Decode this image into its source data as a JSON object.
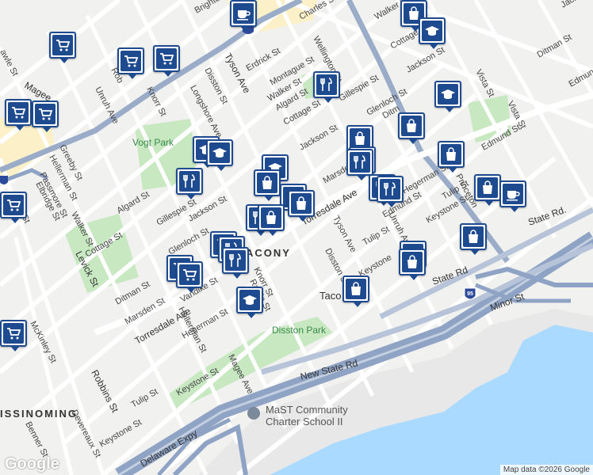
{
  "map": {
    "attribution": "Map data ©2026 Google",
    "logo": "Google",
    "area_labels": [
      "TACONY",
      "ISSINOMING"
    ],
    "parks": [
      "Vogt Park",
      "Disston Park"
    ],
    "school": "MaST Community Charter School II",
    "highways": [
      "New State Rd",
      "Delaware Expy",
      "State Rd.",
      "I-95"
    ],
    "streets": [
      "Brighton St",
      "Charles St",
      "Tyson Ave",
      "Erdrick St",
      "Wellington St",
      "Walker St",
      "Cottage St",
      "Jackson St",
      "Ditman St",
      "Vista St",
      "Edmund St",
      "Montague St",
      "Disston St",
      "Longshore Ave",
      "Unruh Ave",
      "Knorr St",
      "Magee Ave",
      "Greeby St",
      "Hellerman St",
      "Passmore St",
      "Elbridge St",
      "Algard St",
      "Gillespie St",
      "Glenloch St",
      "Torresdale Ave",
      "Marsden St",
      "Hegerman St",
      "Tulip St",
      "Keystone St",
      "Levick St",
      "McKinley St",
      "Robbins St",
      "Devereaux St",
      "Benner St",
      "Vandike St",
      "Rawle St",
      "Minor St",
      "Princeton Ave",
      "Unruh Ave",
      "Edmund St",
      "Tulip St"
    ],
    "pin_types": {
      "cart": "shopping-cart-icon",
      "food": "restaurant-icon",
      "bag": "shopping-bag-icon",
      "school": "school-icon",
      "coffee": "coffee-icon"
    },
    "colors": {
      "pin_border": "#1e4b8f",
      "highway": "#8fa3c4",
      "park": "#c7e8c1",
      "water": "#aadaff",
      "land": "#f1f1ef"
    }
  }
}
